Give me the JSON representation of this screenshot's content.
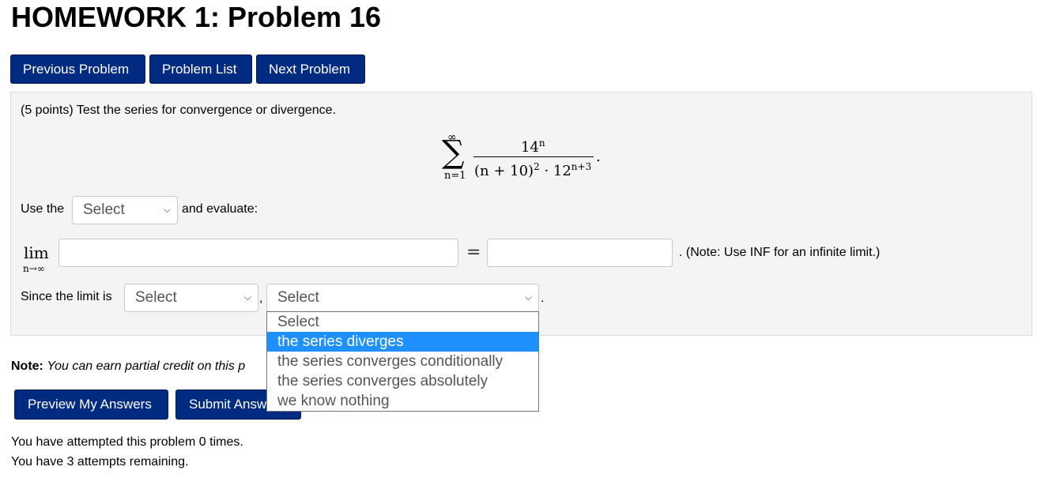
{
  "page_title": "HOMEWORK 1: Problem 16",
  "nav": {
    "previous": "Previous Problem",
    "list": "Problem List",
    "next": "Next Problem"
  },
  "problem": {
    "prompt": "(5 points) Test the series for convergence or divergence.",
    "series": {
      "upper": "∞",
      "sigma": "∑",
      "lower": "n=1",
      "numerator_base": "14",
      "numerator_exp": "n",
      "denominator_main": "(n + 10)",
      "denominator_exp1": "2",
      "denominator_dot": " · 12",
      "denominator_exp2": "n+3",
      "period": "."
    },
    "use_the": "Use the",
    "test_select": "Select",
    "and_evaluate": "and evaluate:",
    "lim_word": "lim",
    "lim_sub": "n→∞",
    "equals": "=",
    "note_inf": ". (Note: Use INF for an infinite limit.)",
    "since": "Since the limit is",
    "limit_select": "Select",
    "comma": ",",
    "conclusion_select": "Select",
    "trailing_period": "."
  },
  "dropdown": {
    "options": [
      "Select",
      "the series diverges",
      "the series converges conditionally",
      "the series converges absolutely",
      "we know nothing"
    ],
    "highlighted_index": 1
  },
  "note": {
    "label": "Note:",
    "text": "You can earn partial credit on this p"
  },
  "actions": {
    "preview": "Preview My Answers",
    "submit": "Submit Answ"
  },
  "attempts": {
    "line1": "You have attempted this problem 0 times.",
    "line2": "You have 3 attempts remaining."
  },
  "colors": {
    "button_bg": "#002b80",
    "highlight": "#1e90ff",
    "panel_bg": "#f4f4f4"
  }
}
